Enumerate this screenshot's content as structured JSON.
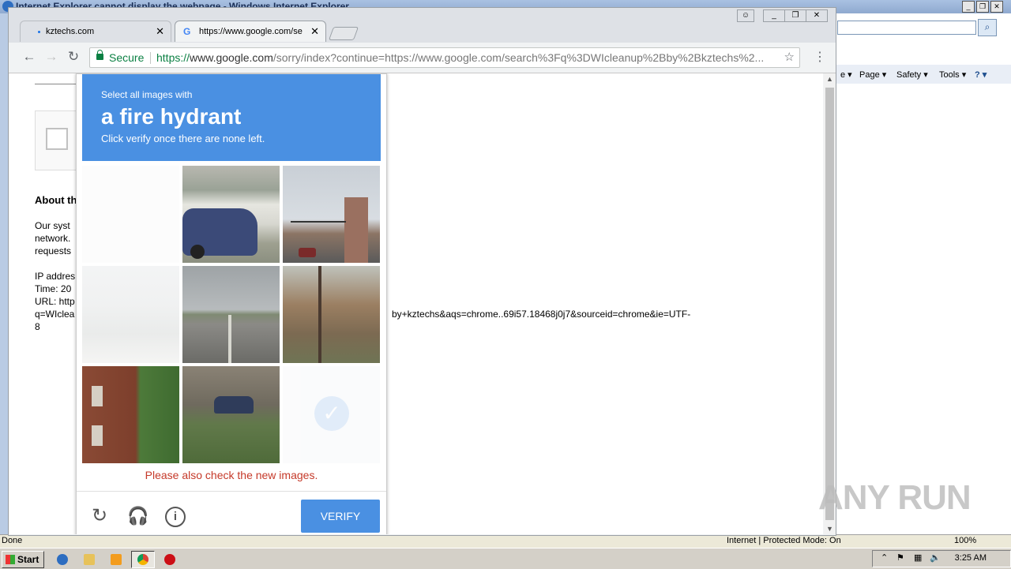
{
  "ie": {
    "title": "Internet Explorer cannot display the webpage - Windows Internet Explorer",
    "cmdbar": {
      "page": "Page ▾",
      "safety": "Safety ▾",
      "tools": "Tools ▾",
      "help": "? ▾",
      "e": "e ▾"
    },
    "status": {
      "left": "Done",
      "zone": "Internet | Protected Mode: On",
      "zoom": "100%"
    }
  },
  "taskbar": {
    "start": "Start",
    "clock": "3:25 AM"
  },
  "chrome": {
    "tabs": [
      {
        "label": "kztechs.com"
      },
      {
        "label": "https://www.google.com/se"
      }
    ],
    "omnibox": {
      "secure": "Secure",
      "scheme": "https://",
      "host": "www.google.com",
      "path": "/sorry/index?continue=https://www.google.com/search%3Fq%3DWIcleanup%2Bby%2Bkztechs%2..."
    }
  },
  "underpage": {
    "heading": "About th",
    "p1": [
      "Our syst",
      "network.",
      "requests"
    ],
    "p2": [
      "IP addres",
      "Time: 20",
      "URL: http",
      "q=WIclea",
      "8"
    ],
    "url_tail": "by+kztechs&aqs=chrome..69i57.18468j0j7&sourceid=chrome&ie=UTF-"
  },
  "captcha": {
    "line1": "Select all images with",
    "target": "a fire hydrant",
    "line3": "Click verify once there are none left.",
    "error": "Please also check the new images.",
    "verify": "VERIFY"
  },
  "watermark": "ANY RUN",
  "colors": {
    "accent": "#4a90e2",
    "error": "#c53929",
    "secure": "#0b8043"
  }
}
